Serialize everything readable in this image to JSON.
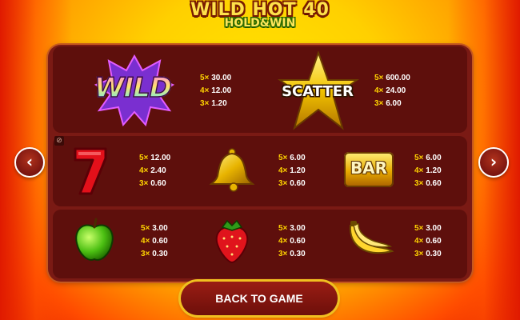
{
  "logo": {
    "line1": "WILD HOT 40",
    "line2": "HOLD&WIN"
  },
  "navigation": {
    "prev_glyph": "‹",
    "next_glyph": "›"
  },
  "back_button_label": "BACK TO GAME",
  "small_icon_glyph": "⊘",
  "symbols": {
    "wild": {
      "label": "WILD",
      "pays": [
        {
          "m": "5×",
          "v": "30.00"
        },
        {
          "m": "4×",
          "v": "12.00"
        },
        {
          "m": "3×",
          "v": "1.20"
        }
      ]
    },
    "scatter": {
      "label": "SCATTER",
      "pays": [
        {
          "m": "5×",
          "v": "600.00"
        },
        {
          "m": "4×",
          "v": "24.00"
        },
        {
          "m": "3×",
          "v": "6.00"
        }
      ]
    },
    "seven": {
      "pays": [
        {
          "m": "5×",
          "v": "12.00"
        },
        {
          "m": "4×",
          "v": "2.40"
        },
        {
          "m": "3×",
          "v": "0.60"
        }
      ]
    },
    "bell": {
      "pays": [
        {
          "m": "5×",
          "v": "6.00"
        },
        {
          "m": "4×",
          "v": "1.20"
        },
        {
          "m": "3×",
          "v": "0.60"
        }
      ]
    },
    "bar": {
      "label": "BAR",
      "pays": [
        {
          "m": "5×",
          "v": "6.00"
        },
        {
          "m": "4×",
          "v": "1.20"
        },
        {
          "m": "3×",
          "v": "0.60"
        }
      ]
    },
    "apple": {
      "pays": [
        {
          "m": "5×",
          "v": "3.00"
        },
        {
          "m": "4×",
          "v": "0.60"
        },
        {
          "m": "3×",
          "v": "0.30"
        }
      ]
    },
    "strawberry": {
      "pays": [
        {
          "m": "5×",
          "v": "3.00"
        },
        {
          "m": "4×",
          "v": "0.60"
        },
        {
          "m": "3×",
          "v": "0.30"
        }
      ]
    },
    "banana": {
      "pays": [
        {
          "m": "5×",
          "v": "3.00"
        },
        {
          "m": "4×",
          "v": "0.60"
        },
        {
          "m": "3×",
          "v": "0.30"
        }
      ]
    }
  },
  "colors": {
    "panel": "#7a1a14",
    "row": "#5e0f0c",
    "multiplier": "#ffd400",
    "button_border": "#f0c020"
  }
}
